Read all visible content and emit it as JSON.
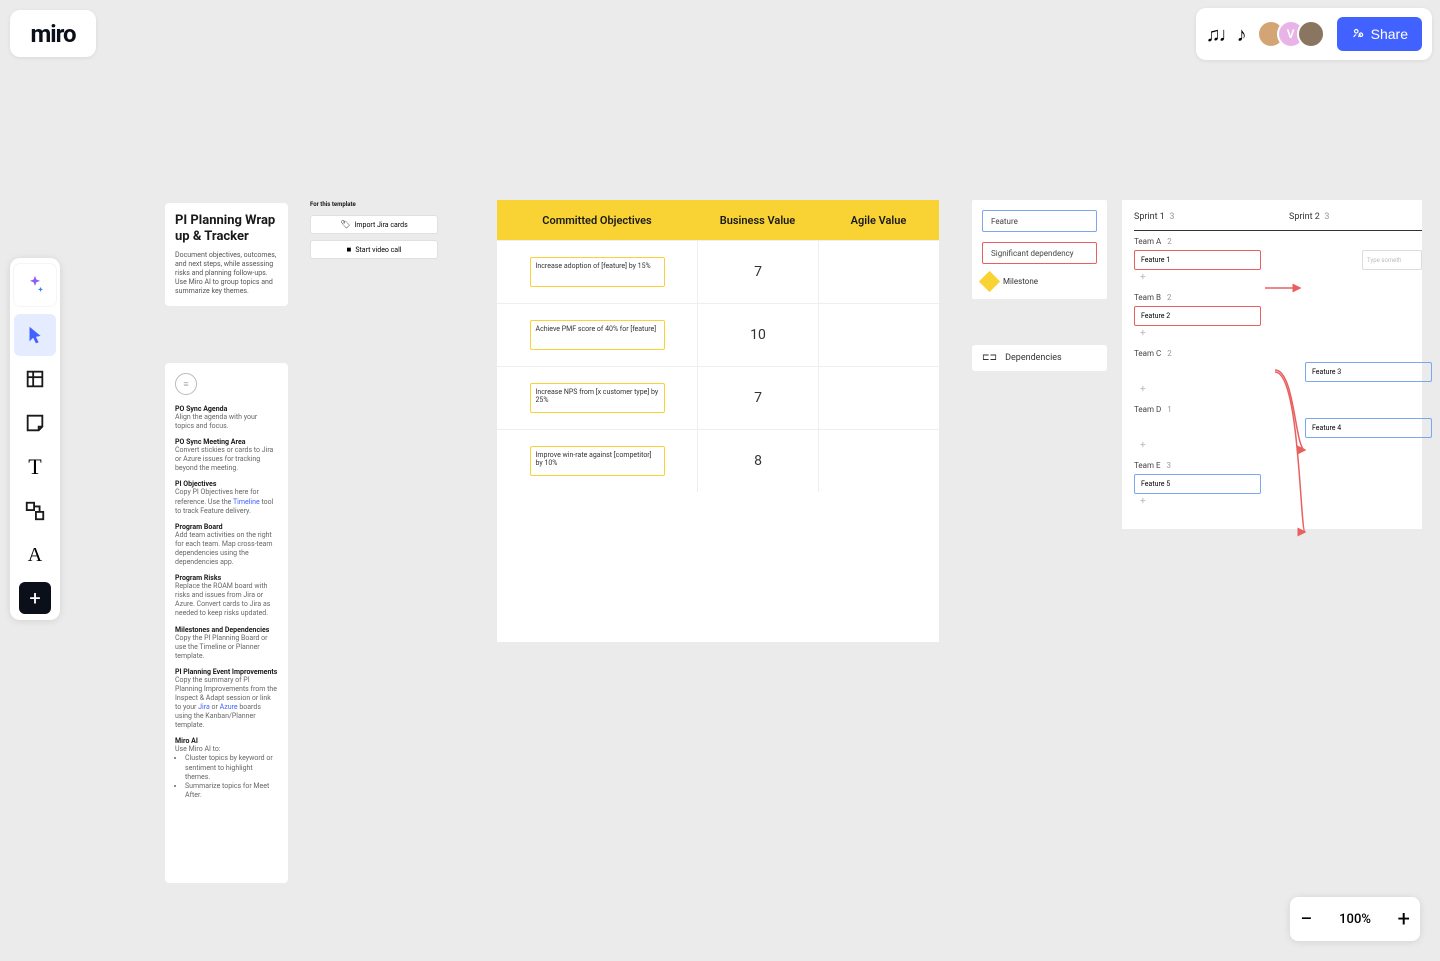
{
  "logo": "miro",
  "topbar": {
    "reactions_glyph": "♫♩♪",
    "avatars": [
      {
        "bg": "#d4a574",
        "label": ""
      },
      {
        "bg": "#e8b4e8",
        "label": "V"
      },
      {
        "bg": "#8a7560",
        "label": ""
      }
    ],
    "share_label": "Share"
  },
  "toolbar": [
    {
      "name": "ai",
      "glyph": "✦",
      "cls": "ai"
    },
    {
      "name": "select",
      "glyph": "↖",
      "cls": "sel"
    },
    {
      "name": "frame",
      "glyph": "▦",
      "cls": ""
    },
    {
      "name": "sticky",
      "glyph": "◻",
      "cls": ""
    },
    {
      "name": "text",
      "glyph": "T",
      "cls": ""
    },
    {
      "name": "shapes",
      "glyph": "⬚⬚",
      "cls": ""
    },
    {
      "name": "pen",
      "glyph": "A",
      "cls": ""
    },
    {
      "name": "add",
      "glyph": "+",
      "cls": "plus"
    }
  ],
  "zoom": {
    "minus": "−",
    "value": "100%",
    "plus": "+"
  },
  "intro": {
    "title": "PI Planning Wrap up & Tracker",
    "body": "Document objectives, outcomes, and next steps, while assessing risks and planning follow-ups. Use Miro AI to group topics and summarize key themes."
  },
  "hint_label": "For this template",
  "buttons": {
    "import": "Import Jira cards",
    "video": "Start video call"
  },
  "guide": [
    {
      "h": "PO Sync Agenda",
      "p": "Align the agenda with your topics and focus."
    },
    {
      "h": "PO Sync Meeting Area",
      "p": "Convert stickies or cards to Jira or Azure issues for tracking beyond the meeting."
    },
    {
      "h": "PI Objectives",
      "p": "Copy PI Objectives here for reference. Use the ",
      "link": "Timeline",
      "p2": " tool to track Feature delivery."
    },
    {
      "h": "Program Board",
      "p": "Add team activities on the right for each team. Map cross-team dependencies using the dependencies app."
    },
    {
      "h": "Program Risks",
      "p": "Replace the ROAM board with risks and issues from Jira or Azure. Convert cards to Jira as needed to keep risks updated."
    },
    {
      "h": "Milestones and Dependencies",
      "p": "Copy the PI Planning Board or use the Timeline or Planner template."
    },
    {
      "h": "PI Planning Event Improvements",
      "p": "Copy the summary of PI Planning Improvements from the Inspect & Adapt session or link to your ",
      "link": "Jira",
      "p2": " or ",
      "link2": "Azure",
      "p3": " boards using the Kanban/Planner template."
    },
    {
      "h": "Miro AI",
      "p": "Use Miro AI to:",
      "bullets": [
        "Cluster topics by keyword or sentiment to highlight themes.",
        "Summarize topics for Meet After."
      ]
    }
  ],
  "objectives": {
    "headers": [
      "Committed Objectives",
      "Business Value",
      "Agile Value"
    ],
    "rows": [
      {
        "text": "Increase adoption of [feature] by 15%",
        "bv": "7",
        "av": ""
      },
      {
        "text": "Achieve PMF score of 40% for [feature]",
        "bv": "10",
        "av": ""
      },
      {
        "text": "Increase NPS from [x customer type] by 25%",
        "bv": "7",
        "av": ""
      },
      {
        "text": "Improve win-rate against [competitor] by 10%",
        "bv": "8",
        "av": ""
      }
    ]
  },
  "legend": {
    "feature": "Feature",
    "dependency": "Significant dependency",
    "milestone": "Milestone",
    "deps_label": "Dependencies"
  },
  "sprints": {
    "headers": [
      {
        "name": "Sprint 1",
        "count": "3"
      },
      {
        "name": "Sprint 2",
        "count": "3"
      }
    ],
    "teams": [
      {
        "name": "Team A",
        "count": "2",
        "card": {
          "label": "Feature 1",
          "color": "red"
        },
        "ghost": "Type someth"
      },
      {
        "name": "Team B",
        "count": "2",
        "card": {
          "label": "Feature 2",
          "color": "red"
        }
      },
      {
        "name": "Team C",
        "count": "2",
        "right": {
          "label": "Feature 3",
          "color": "blue"
        }
      },
      {
        "name": "Team D",
        "count": "1",
        "right": {
          "label": "Feature 4",
          "color": "blue"
        }
      },
      {
        "name": "Team E",
        "count": "3",
        "card": {
          "label": "Feature 5",
          "color": "blue"
        }
      }
    ]
  }
}
